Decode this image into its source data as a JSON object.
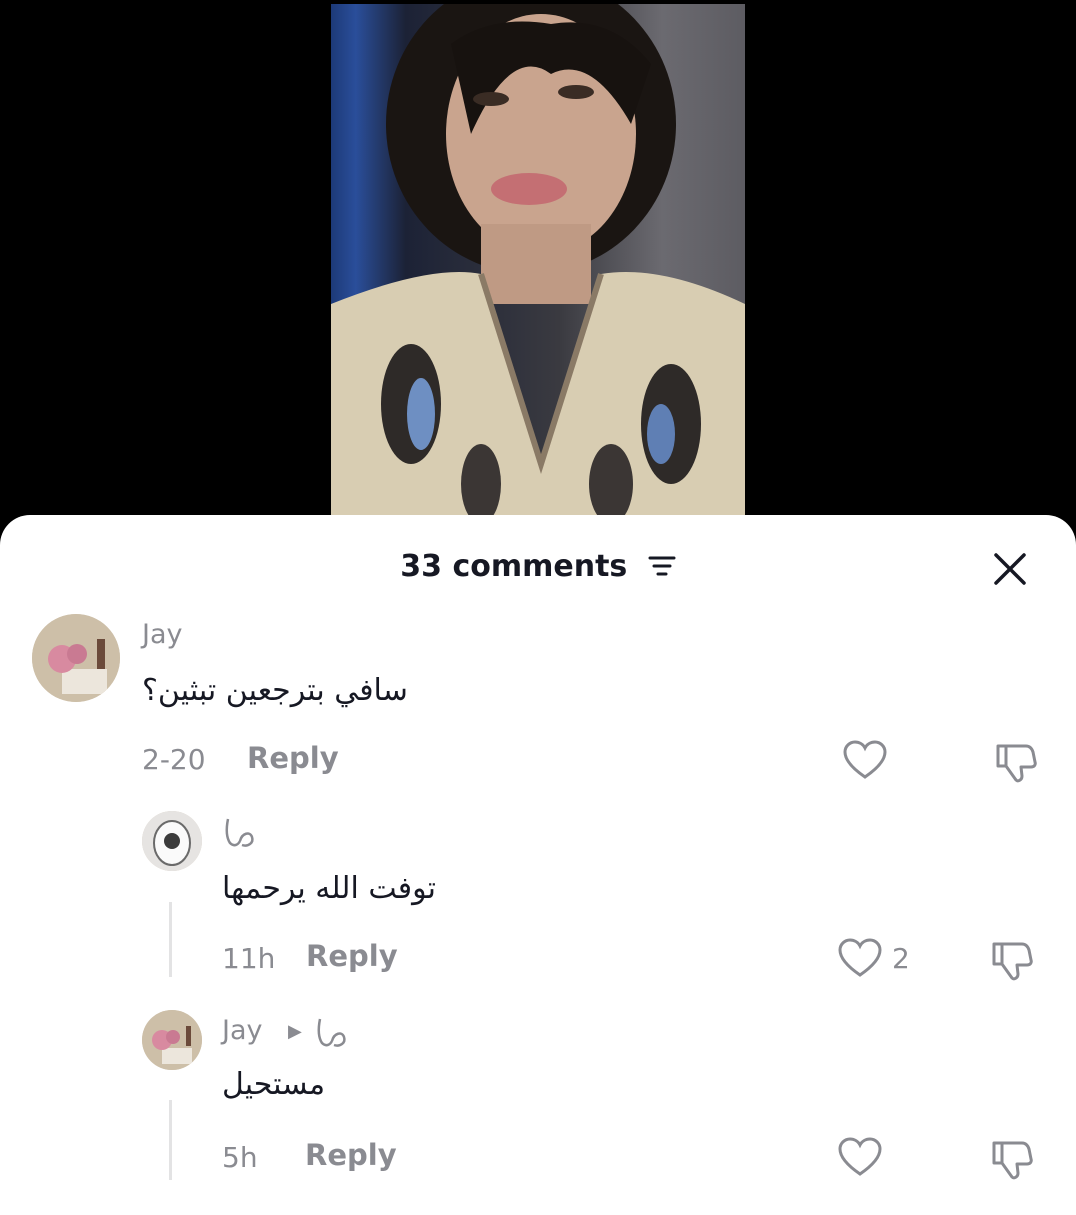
{
  "header": {
    "title": "33 comments"
  },
  "comments": [
    {
      "username": "Jay",
      "text": "سافي بترجعين تبثين؟",
      "time": "2-20",
      "reply_label": "Reply",
      "likes": ""
    },
    {
      "username": "",
      "text": "توفت الله يرحمها",
      "time": "11h",
      "reply_label": "Reply",
      "likes": "2"
    },
    {
      "username": "Jay",
      "text": "مستحيل",
      "time": "5h",
      "reply_label": "Reply",
      "likes": ""
    }
  ],
  "icons": [
    "filter-icon",
    "close-icon",
    "heart-icon",
    "dislike-icon",
    "reply-arrow-icon"
  ],
  "colors": {
    "sheet": "#ffffff",
    "text": "#161823",
    "muted": "#8a8b91"
  }
}
